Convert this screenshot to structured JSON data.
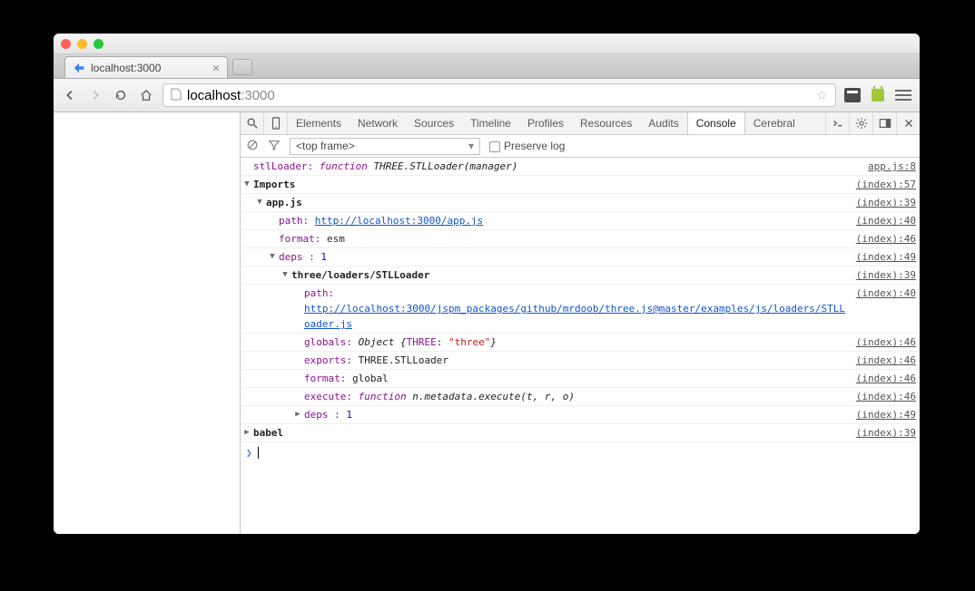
{
  "tab": {
    "title": "localhost:3000"
  },
  "url": {
    "host": "localhost",
    "path": ":3000"
  },
  "devtools_tabs": [
    "Elements",
    "Network",
    "Sources",
    "Timeline",
    "Profiles",
    "Resources",
    "Audits",
    "Console",
    "Cerebral"
  ],
  "active_devtools_tab": "Console",
  "filter": {
    "frame": "<top frame>",
    "preserve_label": "Preserve log"
  },
  "rows": [
    {
      "depth": 0,
      "disc": "",
      "label": "stlLoader:",
      "kind": "func",
      "html": "<span class='k-kw'>function </span><span class='k-func'>THREE.STLLoader(manager)</span>",
      "src": "app.js:8"
    },
    {
      "depth": 0,
      "disc": "open",
      "bold": true,
      "text": "Imports",
      "src": "(index):57"
    },
    {
      "depth": 1,
      "disc": "open",
      "bold": true,
      "text": "app.js",
      "src": "(index):39"
    },
    {
      "depth": 2,
      "disc": "",
      "label": "path:",
      "html": "<a href='#'>http://localhost:3000/app.js</a>",
      "src": "(index):40"
    },
    {
      "depth": 2,
      "disc": "",
      "label": "format:",
      "html": "esm",
      "src": "(index):46"
    },
    {
      "depth": 2,
      "disc": "open",
      "label": "deps :",
      "html": "<span class='k-num'>1</span>",
      "src": "(index):49"
    },
    {
      "depth": 3,
      "disc": "open",
      "bold": true,
      "text": "three/loaders/STLLoader",
      "src": "(index):39"
    },
    {
      "depth": 4,
      "disc": "",
      "label": "path:",
      "html": "<br><a href='#'>http://localhost:3000/jspm_packages/github/mrdoob/three.js@master/examples/js/loaders/STLLoader.js</a>",
      "src": "(index):40"
    },
    {
      "depth": 4,
      "disc": "",
      "label": "globals:",
      "html": "<span class='k-obj'>Object {</span><span class='k-label'>THREE</span>: <span class='k-str'>\"three\"</span><span class='k-obj'>}</span>",
      "src": "(index):46"
    },
    {
      "depth": 4,
      "disc": "",
      "label": "exports:",
      "html": "THREE.STLLoader",
      "src": "(index):46"
    },
    {
      "depth": 4,
      "disc": "",
      "label": "format:",
      "html": "global",
      "src": "(index):46"
    },
    {
      "depth": 4,
      "disc": "",
      "label": "execute:",
      "html": "<span class='k-kw'>function </span><span class='k-func'>n.metadata.execute(t, r, o)</span>",
      "src": "(index):46"
    },
    {
      "depth": 4,
      "disc": "closed",
      "label": "deps :",
      "html": "<span class='k-num'>1</span>",
      "src": "(index):49"
    },
    {
      "depth": 0,
      "disc": "closed",
      "bold": true,
      "text": "babel",
      "src": "(index):39"
    }
  ]
}
